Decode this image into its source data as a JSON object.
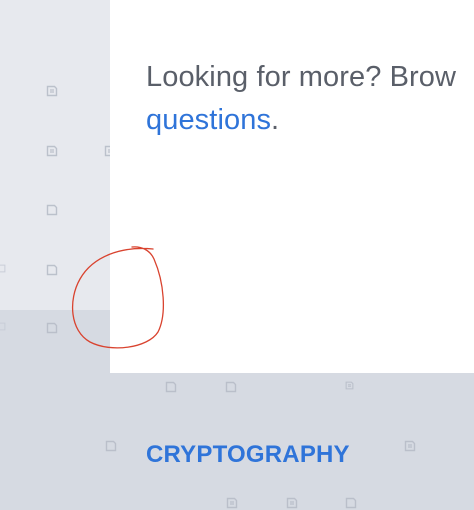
{
  "promo": {
    "text_before": "Looking for more? Brow",
    "link_text": "questions",
    "text_after": "."
  },
  "section": {
    "title": "CRYPTOGRAPHY"
  },
  "icons": {
    "pattern_icon": "document-icon"
  },
  "colors": {
    "link": "#2f74d9",
    "text": "#5a5f69",
    "background_upper": "#e7e9ee",
    "background_lower": "#d6dae2",
    "annotation": "#d9432f"
  }
}
